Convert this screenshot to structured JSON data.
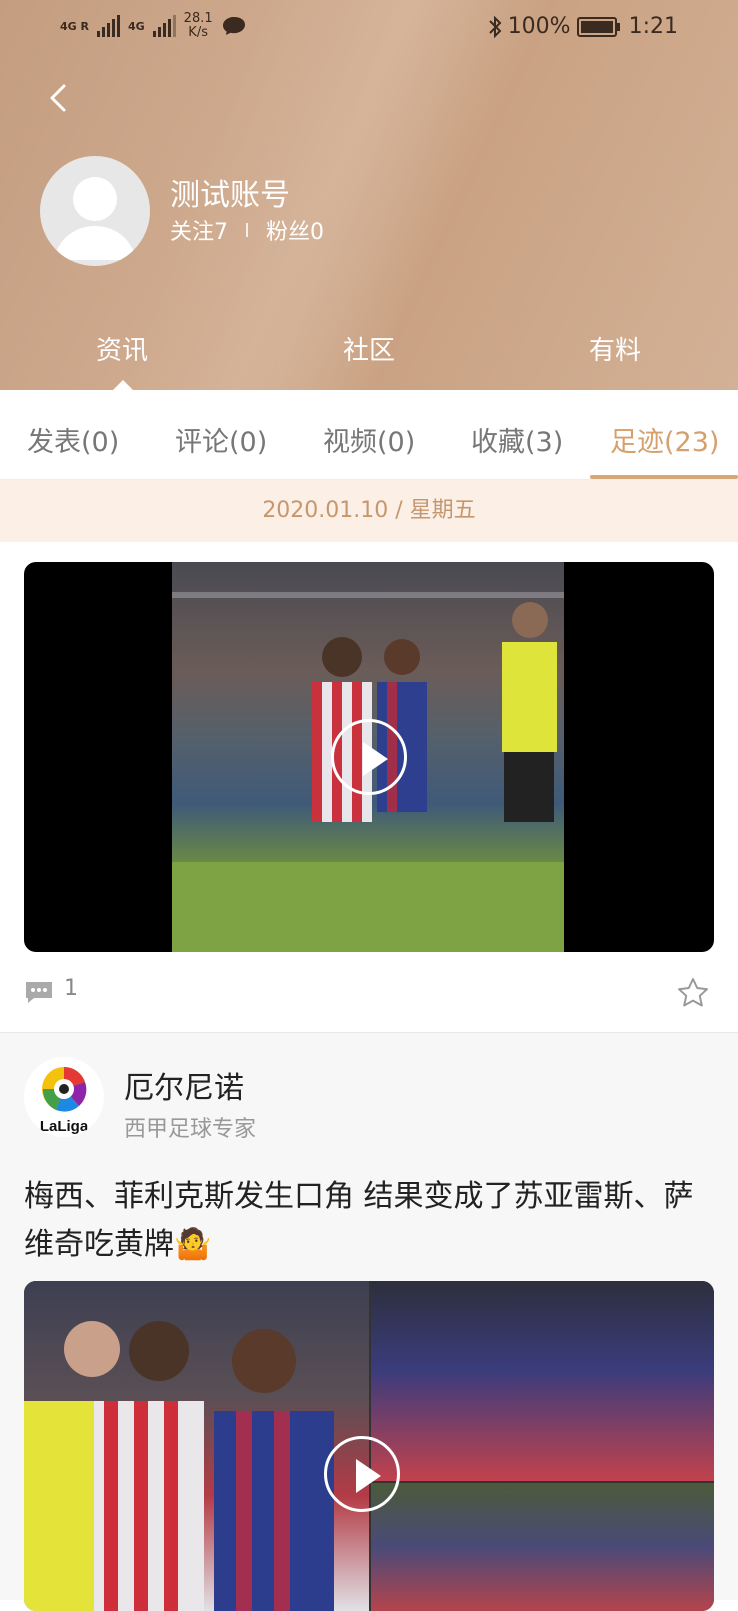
{
  "status_bar": {
    "net1": "4G R",
    "net2": "4G",
    "speed_value": "28.1",
    "speed_unit": "K/s",
    "battery": "100%",
    "time": "1:21"
  },
  "profile": {
    "username": "测试账号",
    "following": "关注7",
    "fans": "粉丝0"
  },
  "main_tabs": [
    {
      "label": "资讯",
      "active": true
    },
    {
      "label": "社区",
      "active": false
    },
    {
      "label": "有料",
      "active": false
    }
  ],
  "sub_tabs": [
    {
      "label": "发表(0)",
      "active": false
    },
    {
      "label": "评论(0)",
      "active": false
    },
    {
      "label": "视频(0)",
      "active": false
    },
    {
      "label": "收藏(3)",
      "active": false
    },
    {
      "label": "足迹(23)",
      "active": true
    }
  ],
  "date_label": "2020.01.10 / 星期五",
  "post1": {
    "comment_count": "1"
  },
  "post2": {
    "author_name": "厄尔尼诺",
    "author_subtitle": "西甲足球专家",
    "avatar_logo_text": "LaLiga",
    "title": "梅西、菲利克斯发生口角 结果变成了苏亚雷斯、萨维奇吃黄牌🤷"
  },
  "colors": {
    "accent": "#d6a06d",
    "header_bg": "#c9a386",
    "date_band_bg": "#fcefe6"
  }
}
